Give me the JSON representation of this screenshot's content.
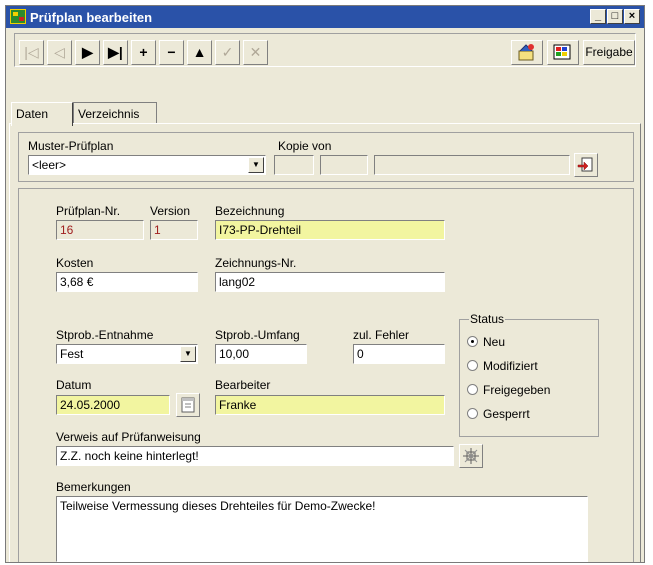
{
  "window": {
    "title": "Prüfplan bearbeiten"
  },
  "titlebar_buttons": {
    "minimize": "_",
    "maximize": "□",
    "close": "×"
  },
  "toolbar": {
    "first": "|◁",
    "prev": "◁",
    "next": "▶",
    "last": "▶|",
    "add": "+",
    "remove": "−",
    "up": "▲",
    "confirm": "✓",
    "cancel": "✕",
    "freigabe_label": "Freigabe"
  },
  "tabs": [
    "Daten",
    "Verzeichnis"
  ],
  "muster": {
    "label": "Muster-Prüfplan",
    "value": "<leer>",
    "kopie_label": "Kopie von"
  },
  "details": {
    "pruefplan_nr_label": "Prüfplan-Nr.",
    "pruefplan_nr": "16",
    "version_label": "Version",
    "version": "1",
    "bezeichnung_label": "Bezeichnung",
    "bezeichnung": "I73-PP-Drehteil",
    "kosten_label": "Kosten",
    "kosten": "3,68 €",
    "zeichnungs_label": "Zeichnungs-Nr.",
    "zeichnungs": "lang02",
    "entnahme_label": "Stprob.-Entnahme",
    "entnahme": "Fest",
    "umfang_label": "Stprob.-Umfang",
    "umfang": "10,00",
    "fehler_label": "zul. Fehler",
    "fehler": "0",
    "datum_label": "Datum",
    "datum": "24.05.2000",
    "bearbeiter_label": "Bearbeiter",
    "bearbeiter": "Franke",
    "verweis_label": "Verweis auf Prüfanweisung",
    "verweis": "Z.Z. noch keine hinterlegt!",
    "bemerkungen_label": "Bemerkungen",
    "bemerkungen": "Teilweise Vermessung dieses Drehteiles für Demo-Zwecke!"
  },
  "status": {
    "title": "Status",
    "options": [
      "Neu",
      "Modifiziert",
      "Freigegeben",
      "Gesperrt"
    ],
    "selected": "Neu"
  },
  "colors": {
    "title_bar": "#2a52a8",
    "highlight_field": "#f2f5a0",
    "readonly_text": "#a02020"
  }
}
